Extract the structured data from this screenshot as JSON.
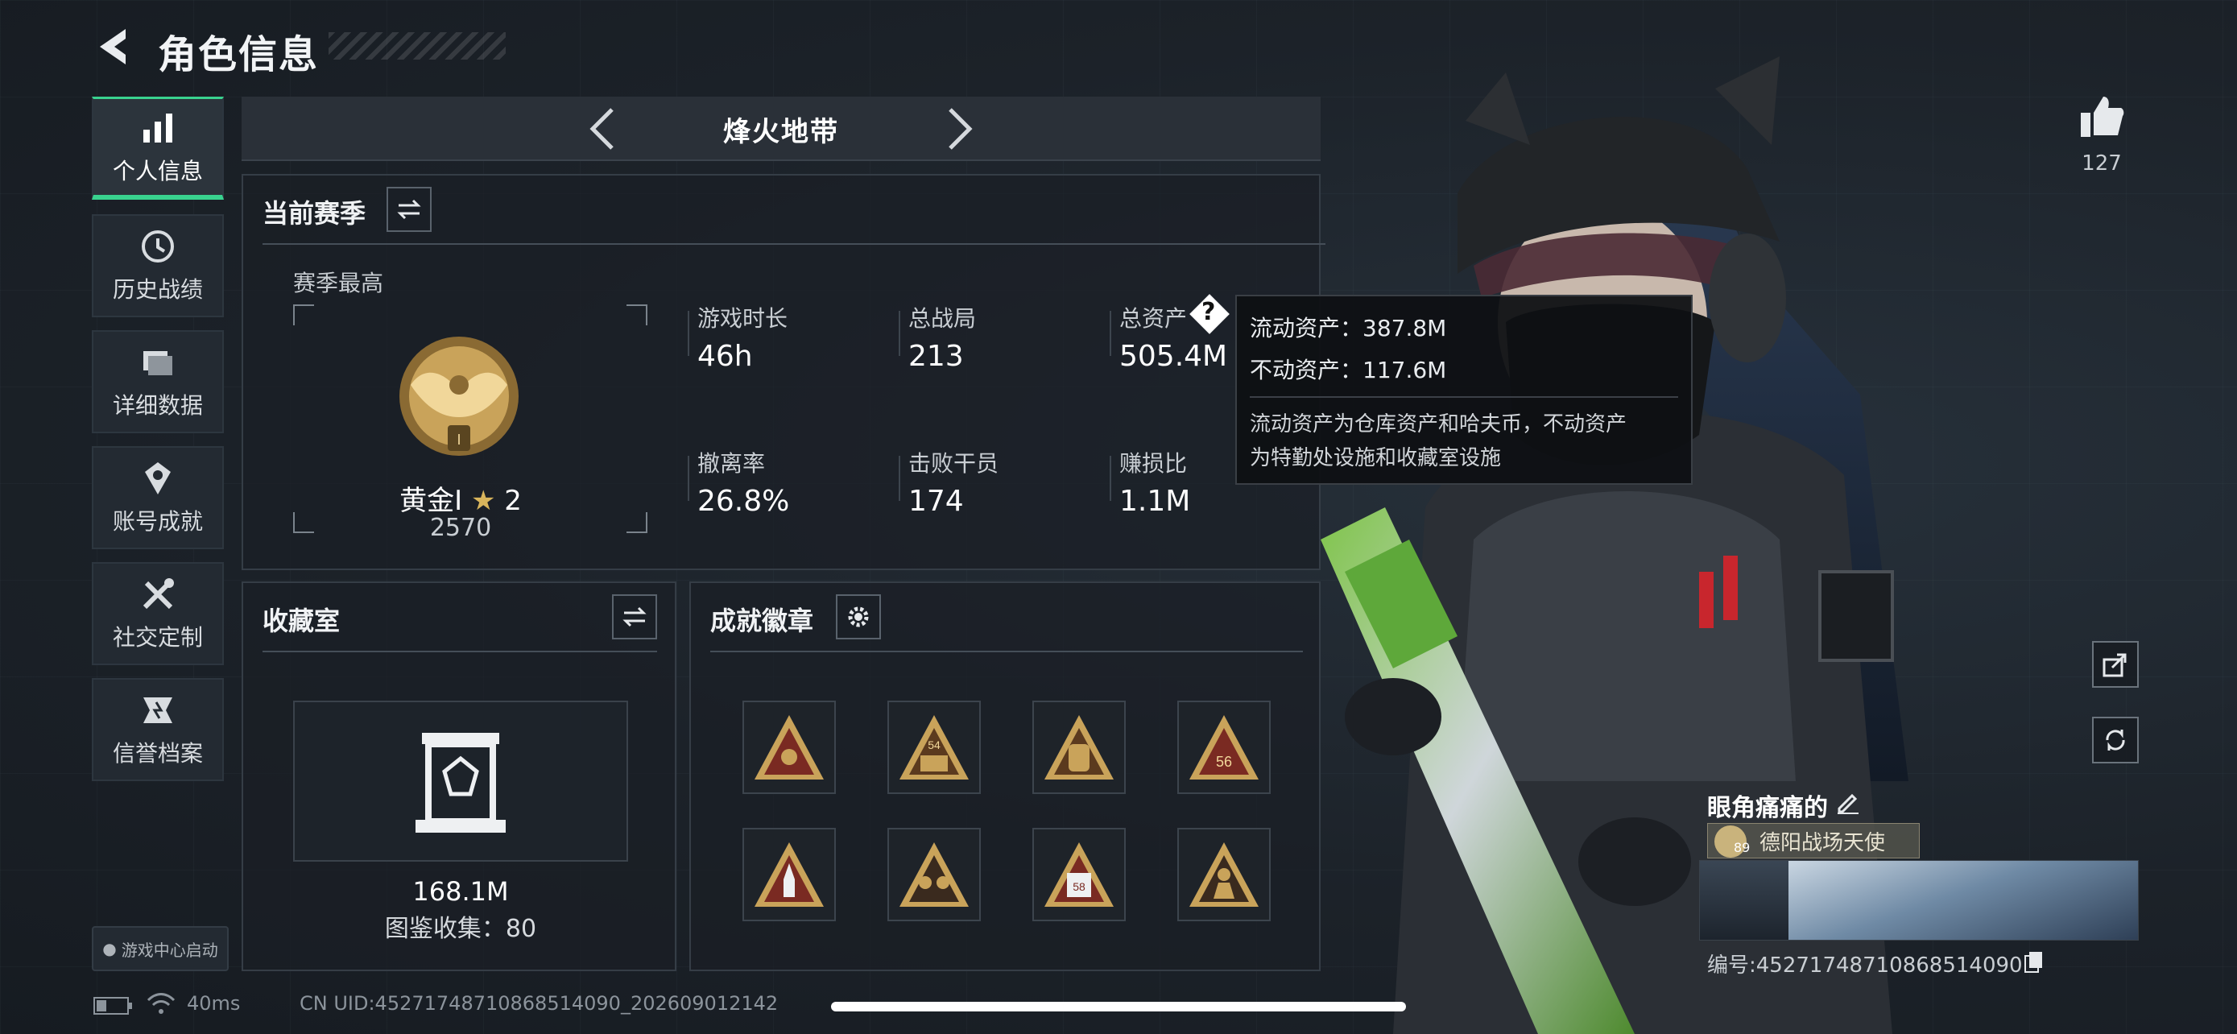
{
  "header": {
    "title": "角色信息"
  },
  "nav": {
    "items": [
      {
        "label": "个人信息",
        "icon": "bar-chart-icon",
        "active": true
      },
      {
        "label": "历史战绩",
        "icon": "history-icon"
      },
      {
        "label": "详细数据",
        "icon": "folder-icon"
      },
      {
        "label": "账号成就",
        "icon": "achievement-icon"
      },
      {
        "label": "社交定制",
        "icon": "tools-icon"
      },
      {
        "label": "信誉档案",
        "icon": "credit-icon"
      }
    ],
    "game_center": "游戏中心启动"
  },
  "mode": {
    "title": "烽火地带"
  },
  "season": {
    "title": "当前赛季",
    "best_label": "赛季最高",
    "rank_name": "黄金I",
    "rank_stars": "2",
    "rank_score": "2570",
    "stats": [
      {
        "label": "游戏时长",
        "value": "46h"
      },
      {
        "label": "总战局",
        "value": "213"
      },
      {
        "label": "总资产",
        "value": "505.4M"
      },
      {
        "label": "撤离率",
        "value": "26.8%"
      },
      {
        "label": "击败干员",
        "value": "174"
      },
      {
        "label": "赚损比",
        "value": "1.1M"
      }
    ]
  },
  "tooltip": {
    "liquid": "流动资产：387.8M",
    "fixed": "不动资产：117.6M",
    "desc1": "流动资产为仓库资产和哈夫币，不动资产",
    "desc2": "为特勤处设施和收藏室设施"
  },
  "collection": {
    "title": "收藏室",
    "value": "168.1M",
    "count_text": "图鉴收集：80"
  },
  "badges": {
    "title": "成就徽章",
    "items": [
      {
        "icon": "eye-triangle-badge-icon",
        "number": ""
      },
      {
        "icon": "crate-badge-icon",
        "number": "54"
      },
      {
        "icon": "backpack-badge-icon",
        "number": ""
      },
      {
        "icon": "trophy-badge-icon",
        "number": "56"
      },
      {
        "icon": "rocket-badge-icon",
        "number": ""
      },
      {
        "icon": "squad-badge-icon",
        "number": ""
      },
      {
        "icon": "calendar-badge-icon",
        "number": "58"
      },
      {
        "icon": "soldier-badge-icon",
        "number": ""
      }
    ]
  },
  "profile": {
    "likes": "127",
    "name": "眼角痛痛的",
    "title_badge": "德阳战场天使",
    "level": "89",
    "id_text": "编号:452717487108685140​90"
  },
  "status": {
    "ping": "40ms",
    "uid": "CN UID:452717487108685140​90_202609012142"
  },
  "colors": {
    "accent_green": "#39d38f",
    "gold": "#c9a35a",
    "panel_border": "#353d46"
  }
}
